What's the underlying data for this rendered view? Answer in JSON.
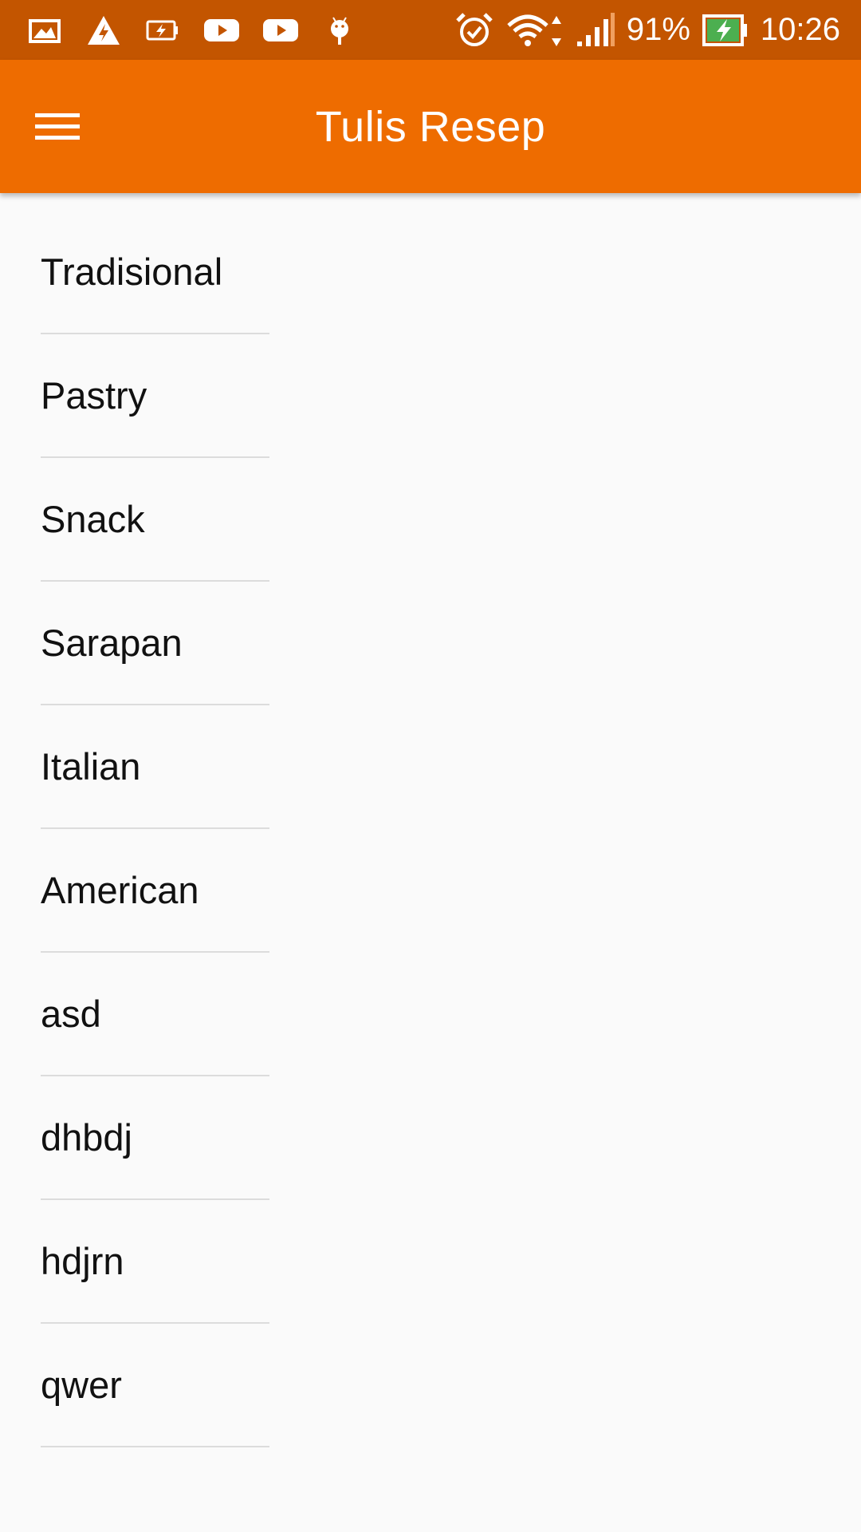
{
  "status_bar": {
    "battery_percent": "91%",
    "time": "10:26",
    "icons_left": [
      "gallery-icon",
      "warning-icon",
      "battery-charging-icon",
      "youtube-icon",
      "youtube-icon",
      "android-debug-icon"
    ],
    "icons_right": [
      "alarm-icon",
      "wifi-icon",
      "signal-icon",
      "battery-icon"
    ],
    "colors": {
      "background": "#c35500",
      "battery_fill": "#4caf50"
    }
  },
  "app_bar": {
    "title": "Tulis Resep",
    "menu_icon": "hamburger-menu-icon",
    "colors": {
      "background": "#ee6c00",
      "text": "#ffffff"
    }
  },
  "categories": [
    "Tradisional",
    "Pastry",
    "Snack",
    "Sarapan",
    "Italian",
    "American",
    "asd",
    "dhbdj",
    "hdjrn",
    "qwer"
  ]
}
